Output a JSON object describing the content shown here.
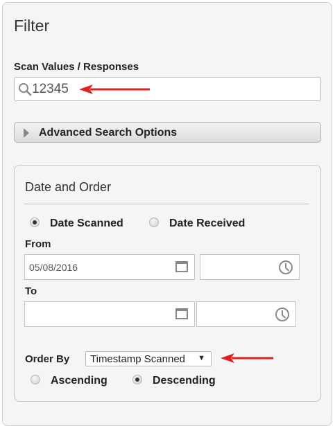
{
  "filter": {
    "title": "Filter",
    "scan_label": "Scan Values / Responses",
    "search_value": "12345",
    "advanced_label": "Advanced Search Options"
  },
  "date_order": {
    "title": "Date and Order",
    "radio_date_scanned": "Date Scanned",
    "radio_date_received": "Date Received",
    "from_label": "From",
    "from_date": "05/08/2016",
    "from_time": "",
    "to_label": "To",
    "to_date": "",
    "to_time": "",
    "order_by_label": "Order By",
    "order_by_value": "Timestamp Scanned",
    "radio_ascending": "Ascending",
    "radio_descending": "Descending"
  },
  "colors": {
    "annotation_arrow": "#e0201e"
  },
  "icons": [
    "search-icon",
    "chevron-right-icon",
    "calendar-icon",
    "clock-icon",
    "dropdown-caret-icon",
    "arrow-annotation"
  ]
}
